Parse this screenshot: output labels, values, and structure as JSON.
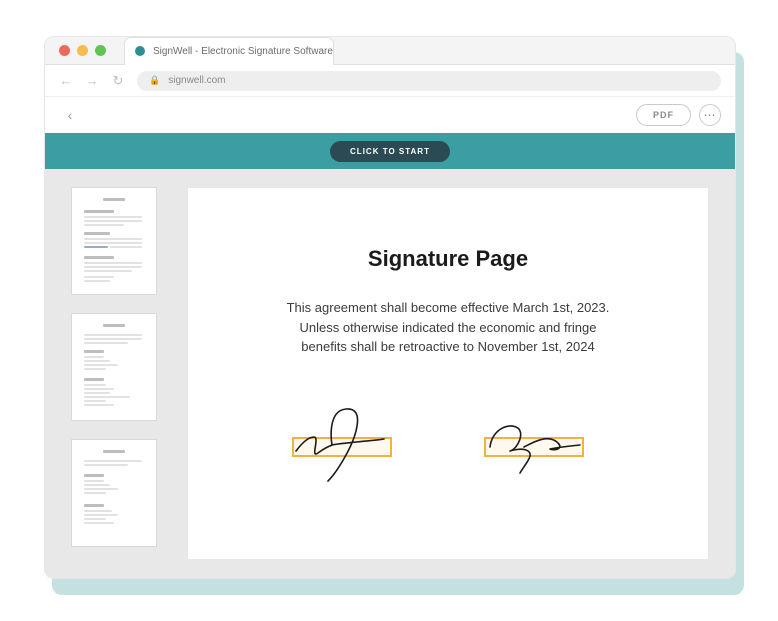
{
  "browser": {
    "tab_title": "SignWell - Electronic Signature Software",
    "url": "signwell.com"
  },
  "toolbar": {
    "pdf_label": "PDF"
  },
  "banner": {
    "cta": "CLICK TO START"
  },
  "thumbnails": {
    "count": 3
  },
  "document": {
    "title": "Signature Page",
    "body_line1": "This agreement shall become effective March 1st, 2023.",
    "body_line2": "Unless otherwise indicated the economic and fringe",
    "body_line3": "benefits shall be retroactive to November 1st, 2024"
  }
}
